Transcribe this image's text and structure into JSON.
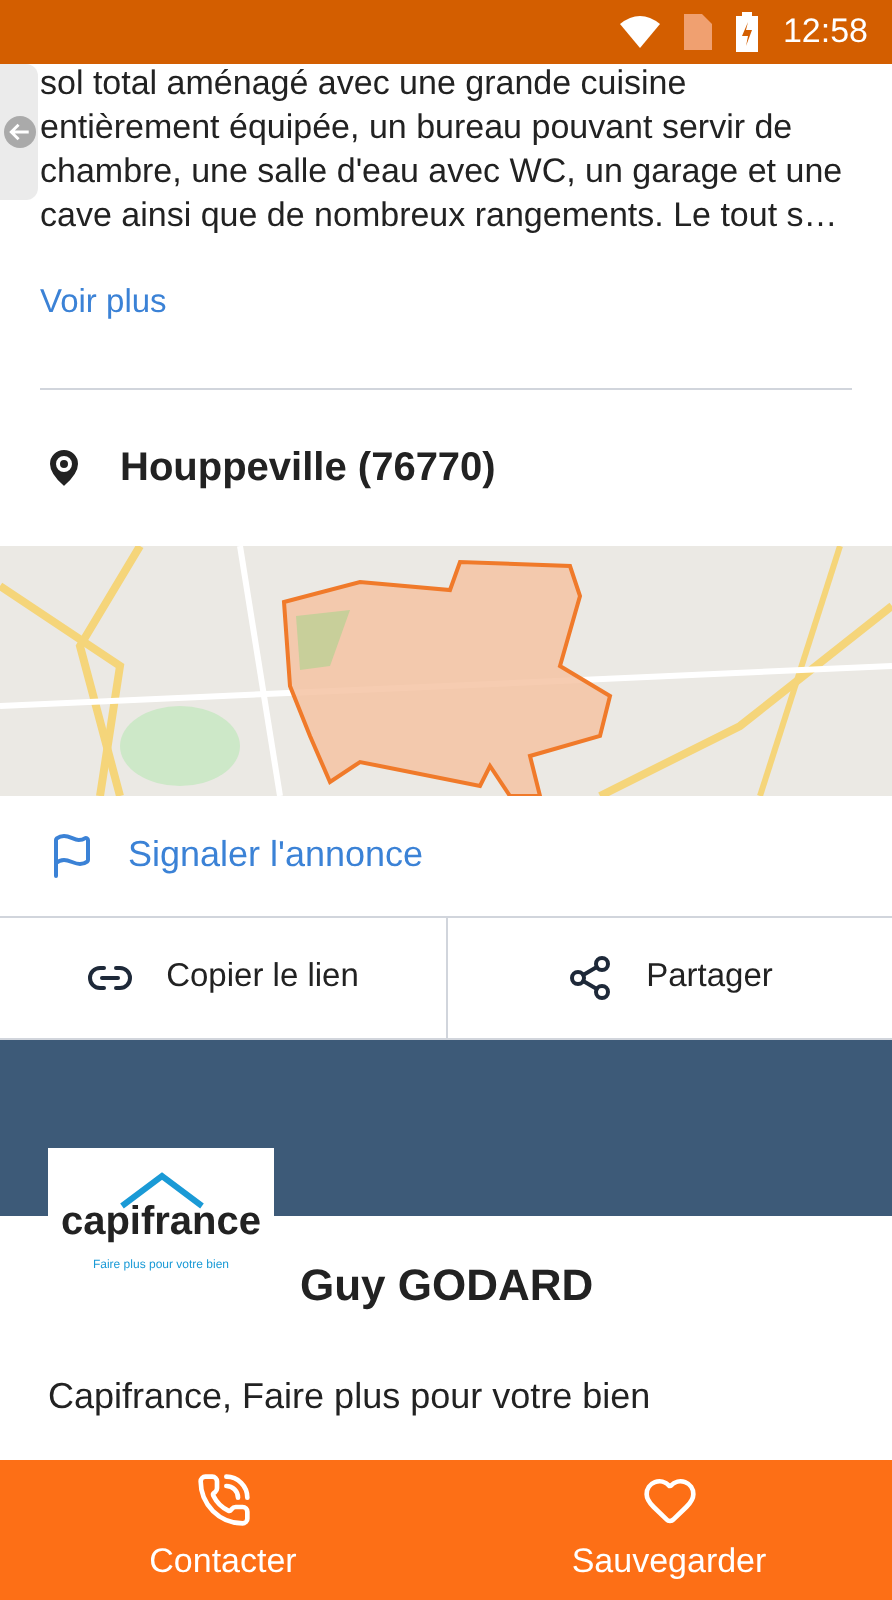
{
  "status_bar": {
    "time": "12:58"
  },
  "description": {
    "text": "sol total aménagé avec une grande cuisine entièrement équipée, un bureau pouvant servir de chambre, une salle d'eau avec WC, un garage et une cave ainsi que de nombreux rangements. Le tout s…",
    "more_link": "Voir plus"
  },
  "location": {
    "label": "Houppeville (76770)"
  },
  "report_link": "Signaler l'annonce",
  "actions": [
    {
      "kind": "link",
      "label": "Copier le lien"
    },
    {
      "kind": "share",
      "label": "Partager"
    }
  ],
  "agent": {
    "logo_text": "capifrance",
    "logo_tagline": "Faire plus pour votre bien",
    "name": "Guy GODARD",
    "agency": "Capifrance, Faire plus pour votre bien"
  },
  "bottom_bar": [
    {
      "kind": "contact",
      "label": "Contacter"
    },
    {
      "kind": "save",
      "label": "Sauvegarder"
    }
  ]
}
